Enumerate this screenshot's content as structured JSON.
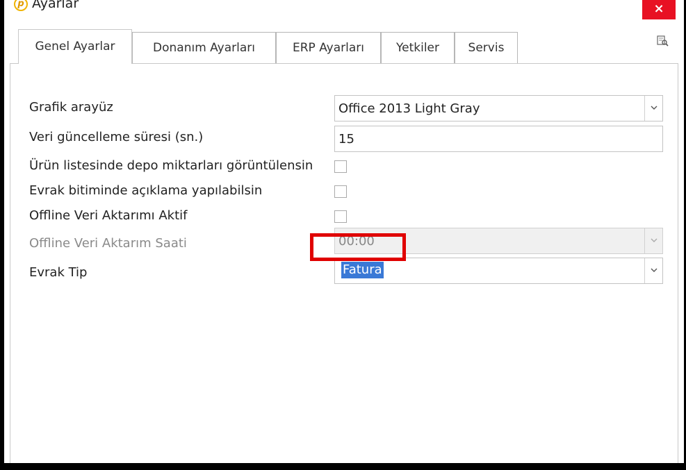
{
  "window": {
    "title": "Ayarlar",
    "close": "×"
  },
  "tabs": [
    "Genel Ayarlar",
    "Donanım Ayarları",
    "ERP Ayarları",
    "Yetkiler",
    "Servis"
  ],
  "form": {
    "grafik_label": "Grafik arayüz",
    "grafik_value": "Office 2013 Light Gray",
    "veri_label": "Veri güncelleme süresi (sn.)",
    "veri_value": "15",
    "urun_label": "Ürün listesinde depo miktarları görüntülensin",
    "evrak_aciklama_label": "Evrak bitiminde açıklama yapılabilsin",
    "offline_aktif_label": "Offline Veri Aktarımı Aktif",
    "offline_saat_label": "Offline Veri Aktarım Saati",
    "offline_saat_value": "00:00",
    "evrak_tip_label": "Evrak Tip",
    "evrak_tip_value": "Fatura"
  },
  "colors": {
    "close_bg": "#e81123",
    "selection": "#3a79d6",
    "highlight_border": "#e00000"
  }
}
